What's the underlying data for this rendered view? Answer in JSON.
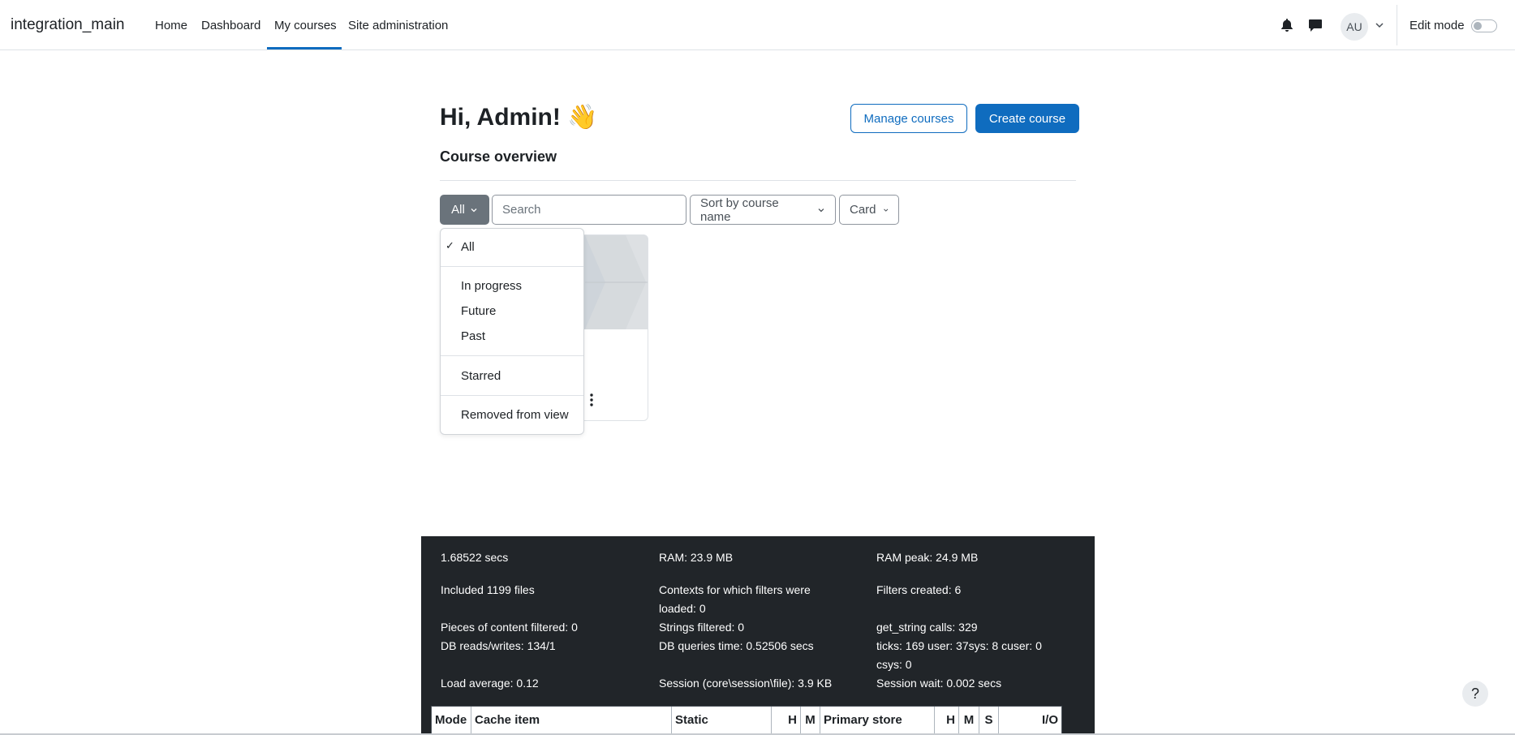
{
  "navbar": {
    "brand": "integration_main",
    "items": [
      "Home",
      "Dashboard",
      "My courses",
      "Site administration"
    ],
    "avatar_initials": "AU",
    "edit_mode_label": "Edit mode"
  },
  "header": {
    "greeting": "Hi, Admin! 👋",
    "manage_courses": "Manage courses",
    "create_course": "Create course"
  },
  "overview": {
    "title": "Course overview",
    "filter_label": "All",
    "search_placeholder": "Search",
    "sort_label": "Sort by course name",
    "view_label": "Card"
  },
  "dropdown": {
    "selected": "All",
    "items": [
      "All",
      "In progress",
      "Future",
      "Past",
      "Starred",
      "Removed from view"
    ]
  },
  "perf": {
    "time": "1.68522 secs",
    "ram": "RAM: 23.9 MB",
    "ram_peak": "RAM peak: 24.9 MB",
    "included": "Included 1199 files",
    "contexts_1": "Contexts for which filters were",
    "contexts_2": "loaded: 0",
    "filters_created": "Filters created: 6",
    "pieces": "Pieces of content filtered: 0",
    "strings": "Strings filtered: 0",
    "get_string": "get_string calls: 329",
    "db_rw": "DB reads/writes: 134/1",
    "db_time": "DB queries time: 0.52506 secs",
    "ticks": "ticks: 169 user: 37sys: 8 cuser: 0",
    "csys": "csys: 0",
    "load": "Load average: 0.12",
    "session": "Session (core\\session\\file): 3.9 KB",
    "session_wait": "Session wait: 0.002 secs",
    "table_headers": [
      "Mode",
      "Cache item",
      "Static",
      "H",
      "M",
      "Primary store",
      "H",
      "M",
      "S",
      "I/O"
    ]
  },
  "help_label": "?",
  "colors": {
    "primary": "#0f6cbf",
    "dark": "#212529",
    "secondary": "#6a737b"
  }
}
